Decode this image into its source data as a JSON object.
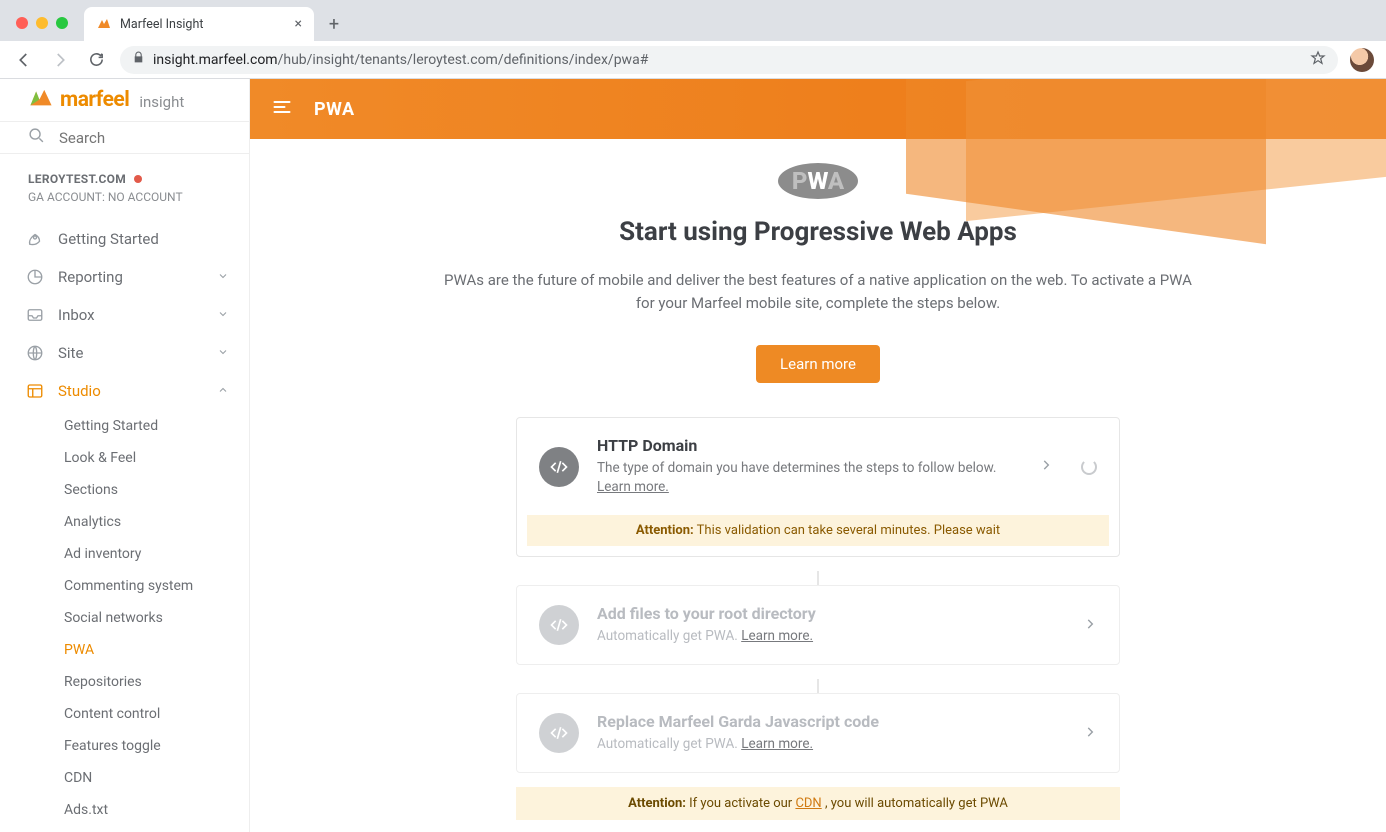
{
  "browser": {
    "tab_title": "Marfeel Insight",
    "url_domain": "insight.marfeel.com",
    "url_path": "/hub/insight/tenants/leroytest.com/definitions/index/pwa#"
  },
  "logo": {
    "word": "marfeel",
    "sub": "insight"
  },
  "search": {
    "placeholder": "Search"
  },
  "account": {
    "domain": "LEROYTEST.COM",
    "ga_line": "GA ACCOUNT: NO ACCOUNT"
  },
  "nav": {
    "getting_started": "Getting Started",
    "reporting": "Reporting",
    "inbox": "Inbox",
    "site": "Site",
    "studio": "Studio"
  },
  "studio_sub": [
    "Getting Started",
    "Look & Feel",
    "Sections",
    "Analytics",
    "Ad inventory",
    "Commenting system",
    "Social networks",
    "PWA",
    "Repositories",
    "Content control",
    "Features toggle",
    "CDN",
    "Ads.txt"
  ],
  "hero": {
    "title": "PWA"
  },
  "page": {
    "title": "Start using Progressive Web Apps",
    "desc": "PWAs are the future of mobile and deliver the best features of a native application on the web. To activate a PWA for your Marfeel mobile site, complete the steps below.",
    "learn_more": "Learn more"
  },
  "steps": {
    "s1": {
      "title": "HTTP Domain",
      "sub_a": "The type of domain you have determines the steps to follow below. ",
      "sub_link": "Learn more.",
      "warn_label": "Attention:",
      "warn_text": " This validation can take several minutes. Please wait"
    },
    "s2": {
      "title": "Add files to your root directory",
      "sub_a": "Automatically get PWA. ",
      "sub_link": "Learn more."
    },
    "s3": {
      "title": "Replace Marfeel Garda Javascript code",
      "sub_a": "Automatically get PWA. ",
      "sub_link": "Learn more."
    }
  },
  "bottom_warn": {
    "label": "Attention:",
    "before": " If you activate our ",
    "link": "CDN",
    "after": " , you will automatically get PWA"
  }
}
